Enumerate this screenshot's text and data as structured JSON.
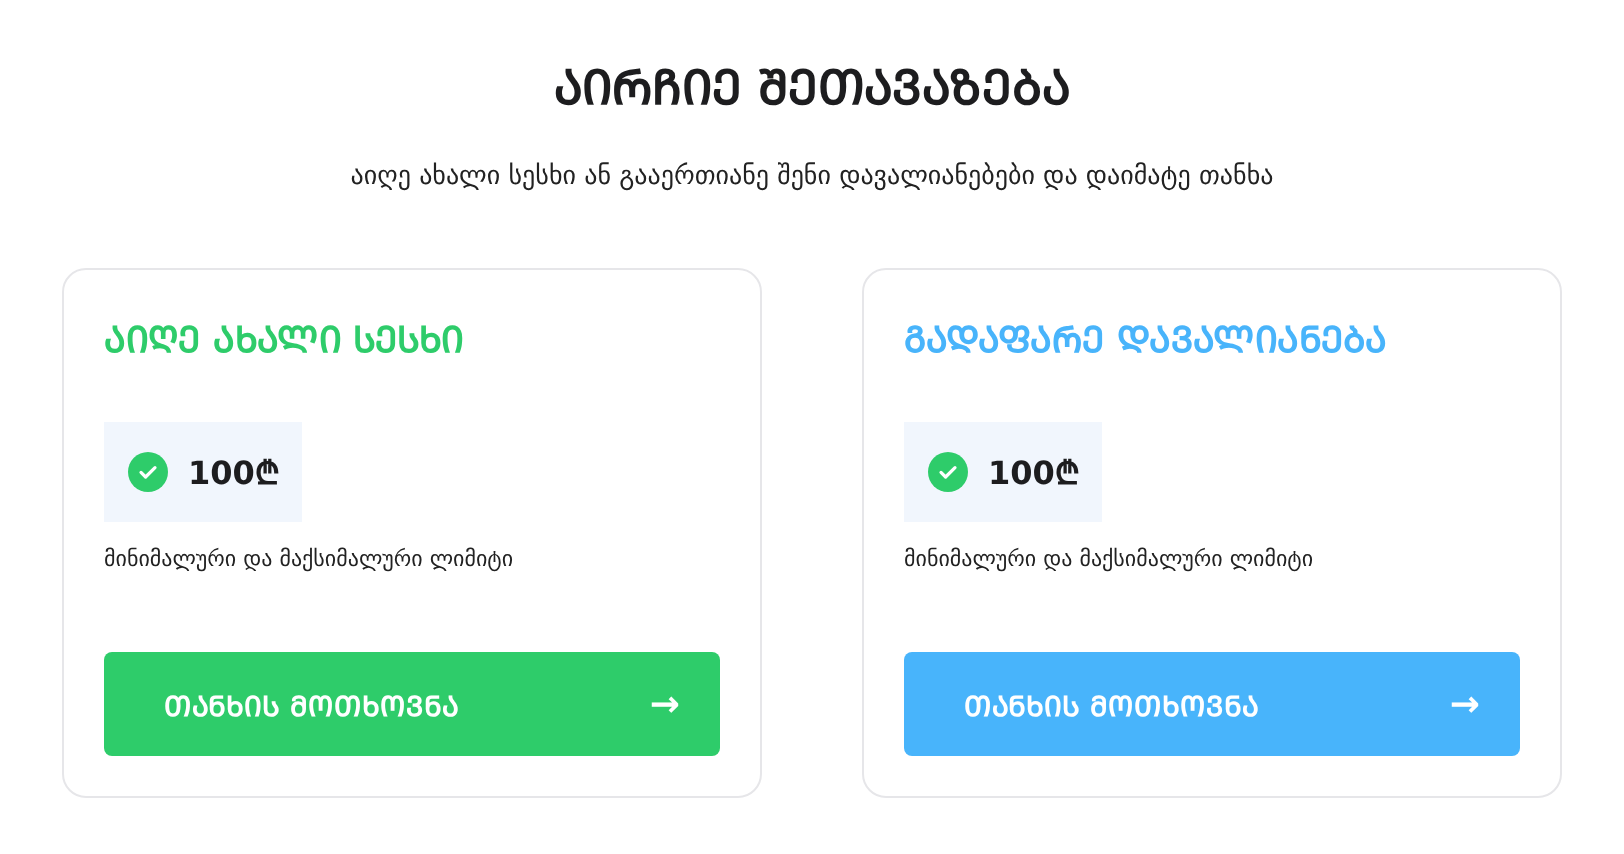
{
  "title": "ᲐᲘᲠᲩᲘᲔ ᲨᲔᲗᲐᲕᲐᲖᲔᲑᲐ",
  "subtitle": "აიღე ახალი სესხი ან გააერთიანე შენი დავალიანებები და დაიმატე თანხა",
  "cards": [
    {
      "title": "ᲐᲘᲦᲔ ᲐᲮᲐᲚᲘ ᲡᲔᲡᲮᲘ",
      "color": "#2ecc6a",
      "amount": "100₾",
      "note": "მინიმალური და მაქსიმალური ლიმიტი",
      "button": "ᲗᲐᲜᲮᲘᲡ ᲛᲝᲗᲮᲝᲕᲜᲐ",
      "arrow": "→"
    },
    {
      "title": "ᲒᲐᲓᲐᲤᲐᲠᲔ ᲓᲐᲕᲐᲚᲘᲐᲜᲔᲑᲐ",
      "color": "#48b4fb",
      "amount": "100₾",
      "note": "მინიმალური და მაქსიმალური ლიმიტი",
      "button": "ᲗᲐᲜᲮᲘᲡ ᲛᲝᲗᲮᲝᲕᲜᲐ",
      "arrow": "→"
    }
  ]
}
